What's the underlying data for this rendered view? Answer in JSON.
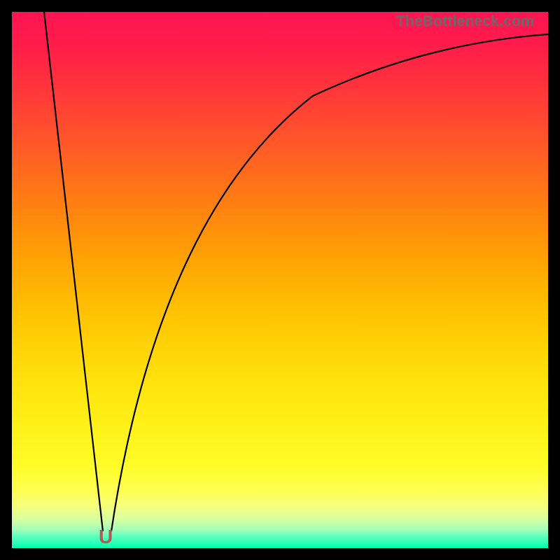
{
  "watermark": {
    "text": "TheBottleneck.com"
  },
  "dip": {
    "glyph": "U"
  },
  "chart_data": {
    "type": "line",
    "title": "",
    "xlabel": "",
    "ylabel": "",
    "xlim": [
      0,
      100
    ],
    "ylim": [
      0,
      100
    ],
    "grid": false,
    "legend": false,
    "axes_visible": false,
    "optimal_x": 18,
    "background_gradient": {
      "orientation": "vertical",
      "stops": [
        {
          "pos": 0.0,
          "color": "#ff1452"
        },
        {
          "pos": 0.5,
          "color": "#ffb003"
        },
        {
          "pos": 0.9,
          "color": "#fdff55"
        },
        {
          "pos": 1.0,
          "color": "#00ffb0"
        }
      ]
    },
    "series": [
      {
        "name": "bottleneck-curve",
        "color": "#000000",
        "x": [
          6,
          8,
          10,
          12,
          14,
          16,
          17,
          18,
          19,
          20,
          22,
          24,
          26,
          28,
          30,
          34,
          38,
          42,
          46,
          50,
          55,
          60,
          65,
          70,
          75,
          80,
          85,
          90,
          95,
          100
        ],
        "y": [
          100,
          84,
          68,
          51,
          35,
          18,
          10,
          2,
          10,
          18,
          32,
          43,
          52,
          59,
          64,
          72,
          78,
          82,
          85,
          87,
          89,
          91,
          92,
          93,
          93.8,
          94.4,
          94.9,
          95.3,
          95.6,
          95.9
        ]
      }
    ],
    "markers": [
      {
        "name": "optimal-dip",
        "x": 18,
        "y": 2,
        "glyph": "U",
        "color": "#b15a55"
      }
    ]
  }
}
